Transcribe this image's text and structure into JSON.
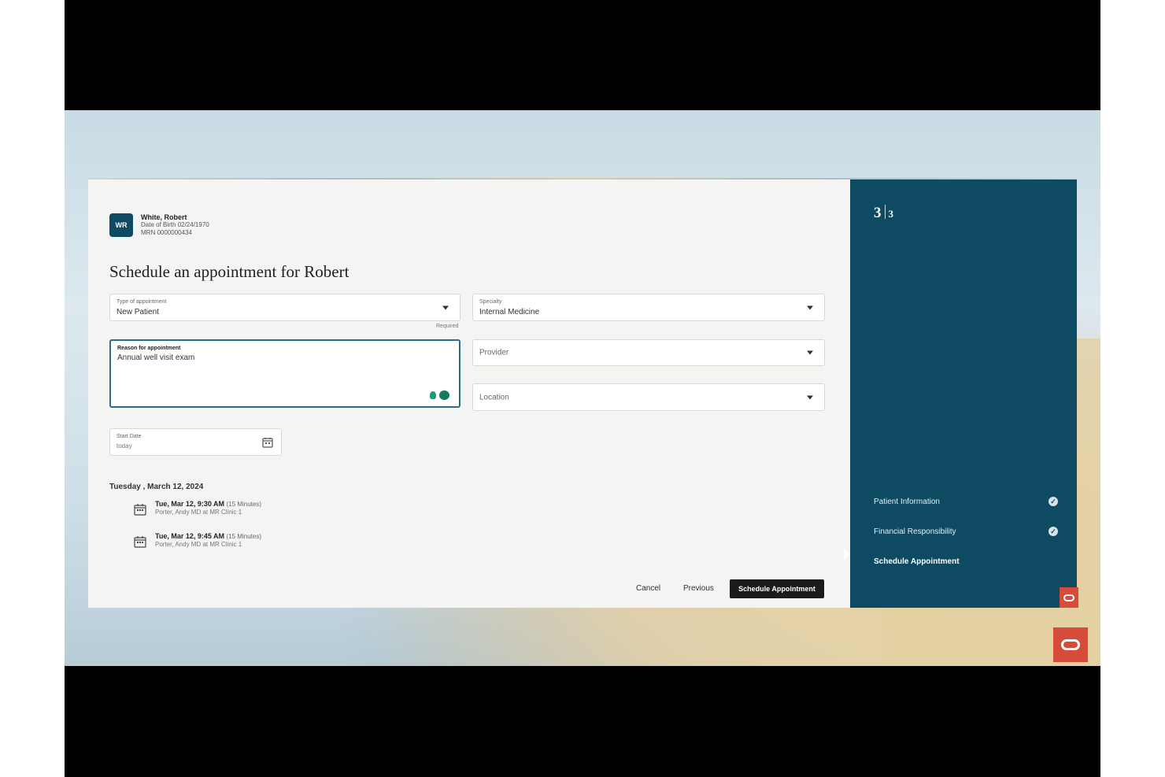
{
  "patient": {
    "initials": "WR",
    "name": "White, Robert",
    "dob_line": "Date of Birth 02/24/1970",
    "mrn_line": "MRN 0000000434"
  },
  "page_title": "Schedule an appointment for Robert",
  "form": {
    "type_of_appointment": {
      "label": "Type of appointment",
      "value": "New Patient"
    },
    "required_note": "Required",
    "specialty": {
      "label": "Specialty",
      "value": "Internal Medicine"
    },
    "reason": {
      "label": "Reason for appointment",
      "value": "Annual well visit exam"
    },
    "provider": {
      "placeholder": "Provider"
    },
    "location": {
      "placeholder": "Location"
    },
    "start_date": {
      "label": "Start Date",
      "value": "today"
    }
  },
  "availability": {
    "day_heading": "Tuesday , March 12, 2024",
    "slots": [
      {
        "when": "Tue, Mar 12, 9:30 AM",
        "duration": "(15 Minutes)",
        "where": "Porter, Andy MD at MR Clinic 1"
      },
      {
        "when": "Tue, Mar 12, 9:45 AM",
        "duration": "(15 Minutes)",
        "where": "Porter, Andy MD at MR Clinic 1"
      }
    ]
  },
  "actions": {
    "cancel": "Cancel",
    "previous": "Previous",
    "schedule": "Schedule Appointment"
  },
  "stepper": {
    "current": "3",
    "total": "3",
    "steps": [
      {
        "label": "Patient Information",
        "done": true
      },
      {
        "label": "Financial Responsibility",
        "done": true
      },
      {
        "label": "Schedule Appointment",
        "done": false
      }
    ]
  },
  "colors": {
    "panel": "#0f4a63",
    "primary_button": "#1b1b1b",
    "oracle_red": "#d64b3a",
    "accent_green": "#137a5e"
  },
  "icons": [
    "calendar-icon",
    "chevron-down-icon",
    "check-circle-icon",
    "lightbulb-icon",
    "chat-bubble-icon",
    "oracle-logo-icon"
  ]
}
